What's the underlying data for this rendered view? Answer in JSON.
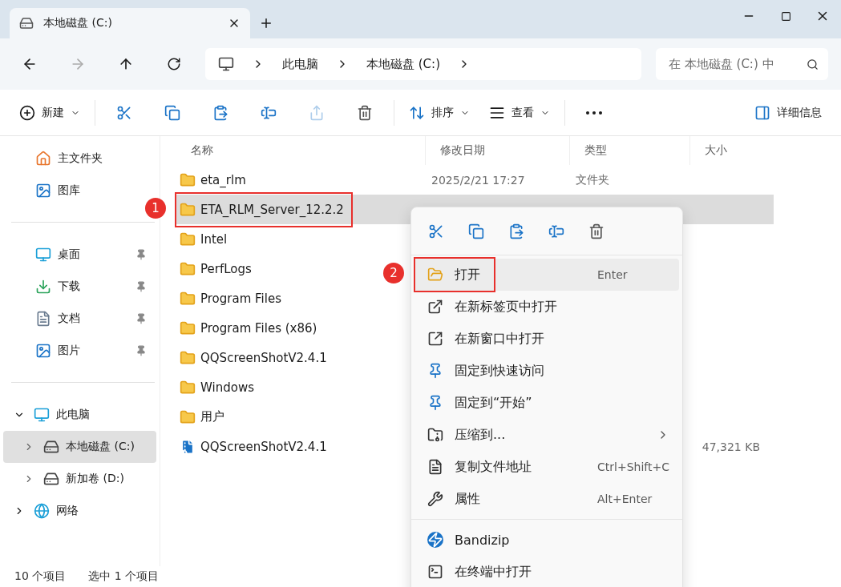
{
  "tabs": [
    {
      "title": "本地磁盘 (C:)",
      "selected": true
    }
  ],
  "address": {
    "path": [
      "此电脑",
      "本地磁盘 (C:)"
    ],
    "search_placeholder": "在 本地磁盘 (C:) 中"
  },
  "toolbar": {
    "new_label": "新建",
    "icon_buttons": [
      {
        "disabled": false
      },
      {
        "disabled": false
      },
      {
        "disabled": false
      },
      {
        "disabled": false
      },
      {
        "disabled": true
      },
      {
        "disabled": false
      }
    ],
    "sort_label": "排序",
    "view_label": "查看",
    "details_label": "详细信息"
  },
  "sidebar": {
    "groups": [
      [
        {
          "label": "主文件夹",
          "pinned": false,
          "selected": false
        },
        {
          "label": "图库",
          "pinned": false,
          "selected": false
        }
      ],
      [
        {
          "label": "桌面",
          "pinned": true,
          "selected": false
        },
        {
          "label": "下载",
          "pinned": true,
          "selected": false
        },
        {
          "label": "文档",
          "pinned": true,
          "selected": false
        },
        {
          "label": "图片",
          "pinned": true,
          "selected": false
        }
      ],
      [
        {
          "label": "此电脑",
          "expanded": true,
          "selected": false,
          "children": [
            {
              "label": "本地磁盘 (C:)",
              "expanded": false,
              "selected": true
            },
            {
              "label": "新加卷 (D:)",
              "expanded": false,
              "selected": false
            }
          ]
        },
        {
          "label": "网络",
          "expanded": false,
          "selected": false
        }
      ]
    ]
  },
  "table": {
    "columns": [
      "名称",
      "修改日期",
      "类型",
      "大小"
    ],
    "rows": [
      {
        "kind": "folder",
        "name": "eta_rlm",
        "date": "2025/2/21 17:27",
        "type": "文件夹",
        "selected": false
      },
      {
        "kind": "folder",
        "name": "ETA_RLM_Server_12.2.2",
        "selected": true
      },
      {
        "kind": "folder",
        "name": "Intel",
        "selected": false
      },
      {
        "kind": "folder",
        "name": "PerfLogs",
        "selected": false
      },
      {
        "kind": "folder",
        "name": "Program Files",
        "selected": false
      },
      {
        "kind": "folder",
        "name": "Program Files (x86)",
        "selected": false
      },
      {
        "kind": "folder",
        "name": "QQScreenShotV2.4.1",
        "selected": false
      },
      {
        "kind": "folder",
        "name": "Windows",
        "selected": false
      },
      {
        "kind": "folder",
        "name": "用户",
        "selected": false
      },
      {
        "kind": "archive",
        "name": "QQScreenShotV2.4.1",
        "size": "47,321 KB",
        "selected": false
      }
    ]
  },
  "status_bar": {
    "count": "10 个项目",
    "selection": "选中 1 个项目"
  },
  "context_menu": {
    "groups": [
      [
        {
          "label": "打开",
          "shortcut": "Enter",
          "submenu": false,
          "selected": true
        },
        {
          "label": "在新标签页中打开",
          "submenu": false,
          "selected": false
        },
        {
          "label": "在新窗口中打开",
          "submenu": false,
          "selected": false
        },
        {
          "label": "固定到快速访问",
          "submenu": false,
          "selected": false
        },
        {
          "label": "固定到“开始”",
          "submenu": false,
          "selected": false
        },
        {
          "label": "压缩到...",
          "submenu": true,
          "selected": false
        },
        {
          "label": "复制文件地址",
          "shortcut": "Ctrl+Shift+C",
          "submenu": false,
          "selected": false
        },
        {
          "label": "属性",
          "shortcut": "Alt+Enter",
          "submenu": false,
          "selected": false
        }
      ],
      [
        {
          "label": "Bandizip",
          "submenu": false,
          "selected": false
        },
        {
          "label": "在终端中打开",
          "submenu": false,
          "selected": false
        }
      ]
    ]
  },
  "annotations": [
    {
      "number": "1"
    },
    {
      "number": "2"
    }
  ]
}
